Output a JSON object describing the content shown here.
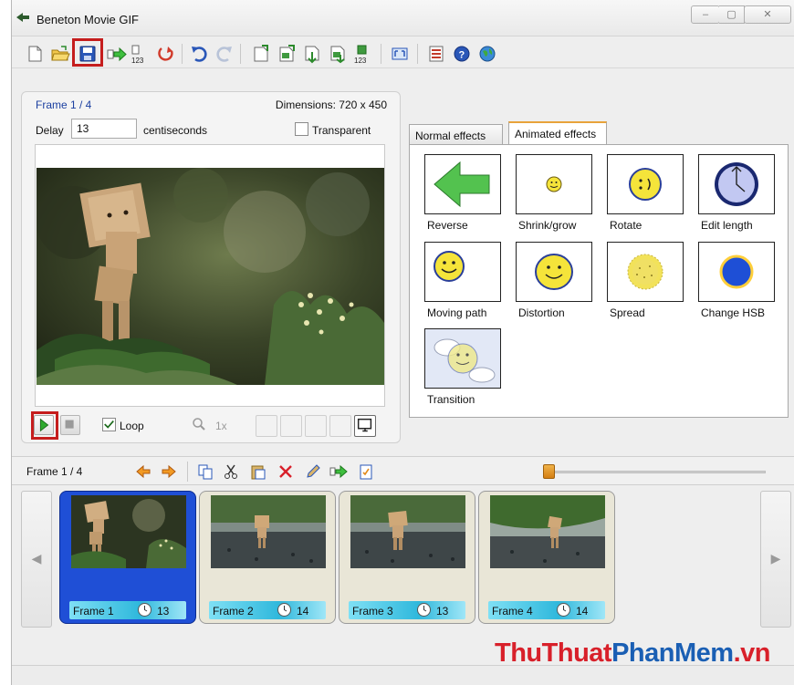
{
  "window": {
    "title": "Beneton Movie GIF",
    "controls": {
      "minimize": "▭",
      "maximize": "▭",
      "close": "☒"
    }
  },
  "toolbar": {
    "icons": [
      "new-file-icon",
      "open-folder-icon",
      "save-icon",
      "export-numbered-icon",
      "numbered-sequence-icon",
      "reload-icon",
      "undo-icon",
      "redo-icon",
      "insert-frame-icon",
      "edit-frame-icon",
      "import-frame-icon",
      "add-frame-icon",
      "numbered-frames-icon",
      "fit-screen-icon",
      "properties-icon",
      "help-icon",
      "web-icon"
    ],
    "numbered_label": "123"
  },
  "preview": {
    "frame_label": "Frame 1 / 4",
    "dimensions": "Dimensions: 720 x 450",
    "delay_label": "Delay",
    "delay_value": "13",
    "delay_unit": "centiseconds",
    "transparent_label": "Transparent",
    "transparent_checked": false,
    "loop_label": "Loop",
    "loop_checked": true,
    "zoom_label": "1x"
  },
  "effects": {
    "tabs": [
      "Normal effects",
      "Animated effects"
    ],
    "active_tab": "Animated effects",
    "items": [
      {
        "label": "Reverse",
        "icon": "reverse-arrow-icon"
      },
      {
        "label": "Shrink/grow",
        "icon": "shrink-grow-icon"
      },
      {
        "label": "Rotate",
        "icon": "rotate-icon"
      },
      {
        "label": "Edit length",
        "icon": "edit-length-clock-icon"
      },
      {
        "label": "Moving path",
        "icon": "moving-path-icon"
      },
      {
        "label": "Distortion",
        "icon": "distortion-icon"
      },
      {
        "label": "Spread",
        "icon": "spread-icon"
      },
      {
        "label": "Change HSB",
        "icon": "change-hsb-icon"
      },
      {
        "label": "Transition",
        "icon": "transition-icon"
      }
    ]
  },
  "frames_toolbar": {
    "frame_label": "Frame 1 / 4"
  },
  "frames": [
    {
      "name": "Frame 1",
      "delay": "13",
      "selected": true
    },
    {
      "name": "Frame 2",
      "delay": "14",
      "selected": false
    },
    {
      "name": "Frame 3",
      "delay": "13",
      "selected": false
    },
    {
      "name": "Frame 4",
      "delay": "14",
      "selected": false
    }
  ],
  "watermark": {
    "part1": "ThuThuat",
    "part2": "PhanMem",
    "part3": ".vn",
    "color1": "#d8202a",
    "color2": "#1a5fb4"
  },
  "colors": {
    "selected_frame": "#1f4fd6",
    "highlight": "#c51d1d",
    "link_blue": "#1b3fa0"
  }
}
